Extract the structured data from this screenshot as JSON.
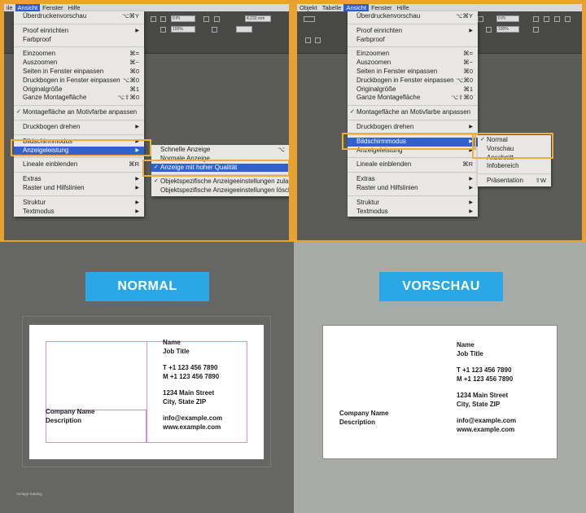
{
  "left_screenshot": {
    "menubar": [
      "ile",
      "Ansicht",
      "Fenster",
      "Hilfe"
    ],
    "toolbar_values": [
      "0 Pt",
      "100%",
      "4,233 mm"
    ],
    "ansicht_menu": [
      {
        "label": "Überdruckenvorschau",
        "shortcut": "⌥⌘Y"
      },
      {
        "sep": true
      },
      {
        "label": "Proof einrichten",
        "submenu": true
      },
      {
        "label": "Farbproof"
      },
      {
        "sep": true
      },
      {
        "label": "Einzoomen",
        "shortcut": "⌘="
      },
      {
        "label": "Auszoomen",
        "shortcut": "⌘−"
      },
      {
        "label": "Seiten in Fenster einpassen",
        "shortcut": "⌘0"
      },
      {
        "label": "Druckbogen in Fenster einpassen",
        "shortcut": "⌥⌘0"
      },
      {
        "label": "Originalgröße",
        "shortcut": "⌘1"
      },
      {
        "label": "Ganze Montagefläche",
        "shortcut": "⌥⇧⌘0"
      },
      {
        "sep": true
      },
      {
        "label": "Montagefläche an Motivfarbe anpassen",
        "checked": true
      },
      {
        "sep": true
      },
      {
        "label": "Druckbogen drehen",
        "submenu": true
      },
      {
        "sep": true
      },
      {
        "label": "Bildschirmmodus",
        "submenu": true
      },
      {
        "label": "Anzeigeleistung",
        "submenu": true,
        "highlighted": true
      },
      {
        "sep": true
      },
      {
        "label": "Lineale einblenden",
        "shortcut": "⌘R"
      },
      {
        "sep": true
      },
      {
        "label": "Extras",
        "submenu": true
      },
      {
        "label": "Raster und Hilfslinien",
        "submenu": true
      },
      {
        "sep": true
      },
      {
        "label": "Struktur",
        "submenu": true
      },
      {
        "label": "Textmodus",
        "submenu": true
      }
    ],
    "anzeige_submenu": [
      {
        "label": "Schnelle Anzeige",
        "shortcut": "⌥"
      },
      {
        "label": "Normale Anzeige"
      },
      {
        "label": "Anzeige mit hoher Qualität",
        "checked": true,
        "highlighted": true
      },
      {
        "sep": true
      },
      {
        "label": "Objektspezifische Anzeigeeinstellungen zulassen",
        "checked": true
      },
      {
        "label": "Objektspezifische Anzeigeeinstellungen löschen"
      }
    ]
  },
  "right_screenshot": {
    "menubar": [
      "Objekt",
      "Tabelle",
      "Ansicht",
      "Fenster",
      "Hilfe"
    ],
    "toolbar_values": [
      "0 Pt",
      "100%"
    ],
    "ansicht_menu": [
      {
        "label": "Überdruckenvorschau",
        "shortcut": "⌥⌘Y"
      },
      {
        "sep": true
      },
      {
        "label": "Proof einrichten",
        "submenu": true
      },
      {
        "label": "Farbproof"
      },
      {
        "sep": true
      },
      {
        "label": "Einzoomen",
        "shortcut": "⌘="
      },
      {
        "label": "Auszoomen",
        "shortcut": "⌘−"
      },
      {
        "label": "Seiten in Fenster einpassen",
        "shortcut": "⌘0"
      },
      {
        "label": "Druckbogen in Fenster einpassen",
        "shortcut": "⌥⌘0"
      },
      {
        "label": "Originalgröße",
        "shortcut": "⌘1"
      },
      {
        "label": "Ganze Montagefläche",
        "shortcut": "⌥⇧⌘0"
      },
      {
        "sep": true
      },
      {
        "label": "Montagefläche an Motivfarbe anpassen",
        "checked": true
      },
      {
        "sep": true
      },
      {
        "label": "Druckbogen drehen",
        "submenu": true
      },
      {
        "sep": true
      },
      {
        "label": "Bildschirmmodus",
        "submenu": true,
        "highlighted": true
      },
      {
        "label": "Anzeigeleistung",
        "submenu": true
      },
      {
        "sep": true
      },
      {
        "label": "Lineale einblenden",
        "shortcut": "⌘R"
      },
      {
        "sep": true
      },
      {
        "label": "Extras",
        "submenu": true
      },
      {
        "label": "Raster und Hilfslinien",
        "submenu": true
      },
      {
        "sep": true
      },
      {
        "label": "Struktur",
        "submenu": true
      },
      {
        "label": "Textmodus",
        "submenu": true
      }
    ],
    "modus_submenu": [
      {
        "label": "Normal",
        "checked": true
      },
      {
        "label": "Vorschau"
      },
      {
        "label": "Anschnitt"
      },
      {
        "label": "Infobereich"
      },
      {
        "sep": true
      },
      {
        "label": "Präsentation",
        "shortcut": "⇧W"
      }
    ]
  },
  "bottom_left": {
    "banner": "NORMAL",
    "footnote": "Vorlage Katalog"
  },
  "bottom_right": {
    "banner": "VORSCHAU"
  },
  "card": {
    "name": "Name",
    "job_title": "Job Title",
    "phone_t": "T  +1 123 456 7890",
    "phone_m": "M  +1 123 456 7890",
    "address1": "1234 Main Street",
    "address2": "City, State ZIP",
    "email": "info@example.com",
    "web": "www.example.com",
    "company": "Company Name",
    "description": "Description"
  },
  "colors": {
    "banner_blue": "#2aa8e6",
    "highlight_frame": "#eeae38",
    "menu_highlight": "#2f62cf"
  }
}
